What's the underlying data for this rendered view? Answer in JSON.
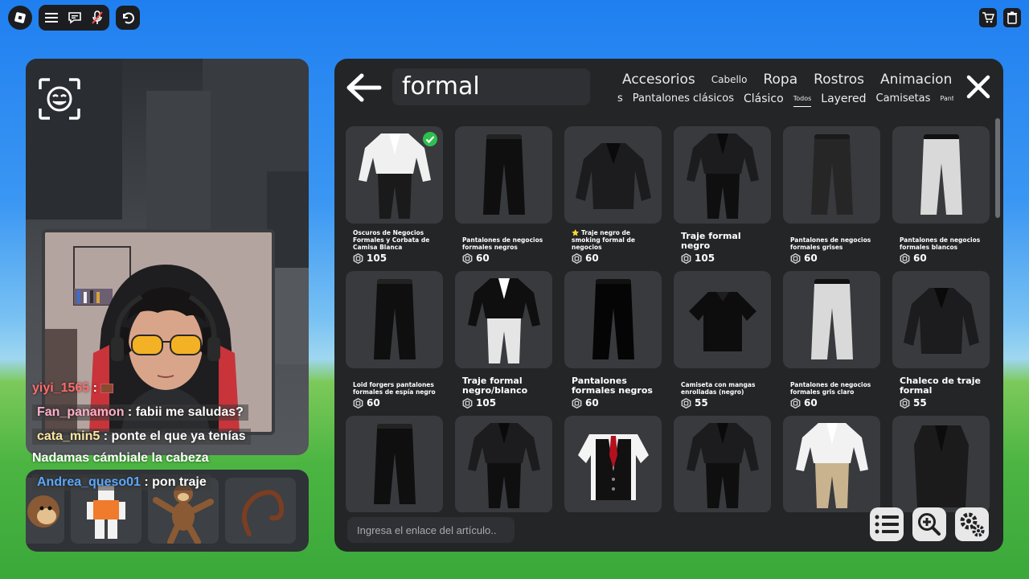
{
  "topbar": {
    "left_icons": [
      "roblox-logo-icon",
      "menu-icon",
      "chat-icon",
      "mic-icon",
      "undo-icon"
    ],
    "right_icons": [
      "cart-icon",
      "trash-icon"
    ]
  },
  "chat": [
    {
      "user": "yiyi_1565",
      "sep": " : ",
      "text": "",
      "user_color": "#ff6b6b",
      "emoji": true
    },
    {
      "user": "Fan_panamon",
      "sep": " : ",
      "text": "fabii me saludas?",
      "user_color": "#ffb0c8"
    },
    {
      "user": "cata_min5",
      "sep": " : ",
      "text": "ponte el que ya tenías",
      "user_color": "#ffe6a0"
    },
    {
      "user": "",
      "sep": "",
      "text": "Nadamas cámbiale la cabeza",
      "user_color": "#ffffff"
    },
    {
      "user": "Andrea_queso01",
      "sep": " : ",
      "text": "pon traje",
      "user_color": "#5aa8ff"
    }
  ],
  "catalog": {
    "search_value": "formal",
    "categories": [
      {
        "label": "Accesorios",
        "size": "normal",
        "active": false
      },
      {
        "label": "Cabello",
        "size": "small",
        "active": false
      },
      {
        "label": "Ropa",
        "size": "normal",
        "active": true
      },
      {
        "label": "Rostros",
        "size": "normal",
        "active": false
      },
      {
        "label": "Animacion",
        "size": "normal",
        "active": false
      }
    ],
    "subcategories": [
      {
        "label": "s",
        "size": "normal",
        "active": false
      },
      {
        "label": "Pantalones clásicos",
        "size": "normal",
        "active": false
      },
      {
        "label": "Clásico",
        "size": "big",
        "active": false
      },
      {
        "label": "Todos",
        "size": "tiny",
        "active": true
      },
      {
        "label": "Layered",
        "size": "big",
        "active": false
      },
      {
        "label": "Camisetas",
        "size": "normal",
        "active": false
      },
      {
        "label": "Pantalones",
        "size": "tiny",
        "active": false
      }
    ],
    "items": [
      {
        "name": "Pantalones Grises Oscuros de Negocios Formales y Corbata de Camisa Blanca",
        "price": "105",
        "kind": "suit-white-shirt",
        "large": false,
        "owned": true
      },
      {
        "name": "Pantalones de negocios formales negros",
        "price": "60",
        "kind": "pants-black",
        "large": false
      },
      {
        "name": "⭐ Traje negro de smoking formal de negocios",
        "price": "60",
        "kind": "jacket-black",
        "large": false
      },
      {
        "name": "Traje formal negro",
        "price": "105",
        "kind": "suit-black",
        "large": true
      },
      {
        "name": "Pantalones de negocios formales grises",
        "price": "60",
        "kind": "pants-darkgray",
        "large": false
      },
      {
        "name": "Pantalones de negocios formales blancos",
        "price": "60",
        "kind": "pants-white",
        "large": false
      },
      {
        "name": "Loid forgers pantalones formales de espía negro",
        "price": "60",
        "kind": "pants-black",
        "large": false
      },
      {
        "name": "Traje formal negro/blanco",
        "price": "105",
        "kind": "suit-bw",
        "large": true
      },
      {
        "name": "Pantalones formales negros",
        "price": "60",
        "kind": "pants-black2",
        "large": true
      },
      {
        "name": "Camiseta con mangas enrolladas (negro)",
        "price": "55",
        "kind": "shirt-black",
        "large": false
      },
      {
        "name": "Pantalones de negocios formales gris claro",
        "price": "60",
        "kind": "pants-white",
        "large": false
      },
      {
        "name": "Chaleco de traje formal",
        "price": "55",
        "kind": "jacket-black",
        "large": true
      },
      {
        "name": "",
        "price": "",
        "kind": "pants-black",
        "large": false
      },
      {
        "name": "",
        "price": "",
        "kind": "suit-black",
        "large": false
      },
      {
        "name": "",
        "price": "",
        "kind": "vest-red-tie",
        "large": false
      },
      {
        "name": "",
        "price": "",
        "kind": "suit-black",
        "large": false
      },
      {
        "name": "",
        "price": "",
        "kind": "suit-khaki",
        "large": false
      },
      {
        "name": "",
        "price": "",
        "kind": "vest-black",
        "large": false
      }
    ],
    "link_placeholder": "Ingresa el enlace del artículo..",
    "tool_icons": [
      "list-icon",
      "zoom-in-icon",
      "settings-icon"
    ]
  }
}
